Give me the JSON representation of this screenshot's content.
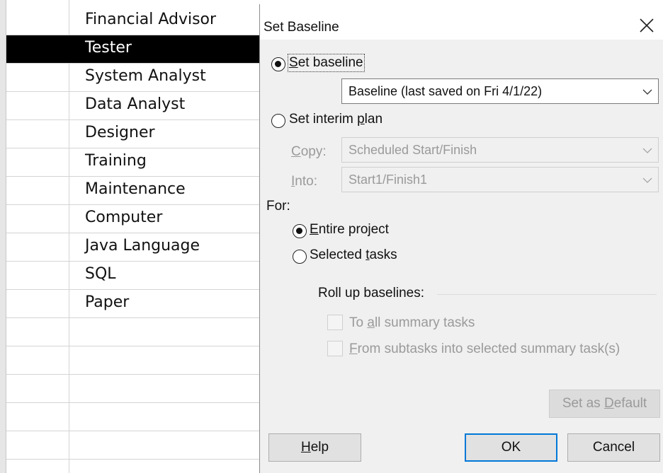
{
  "sheet": {
    "rows": [
      "Financial Advisor",
      "Tester",
      "System Analyst",
      "Data Analyst",
      "Designer",
      "Training",
      "Maintenance",
      "Computer",
      "Java Language",
      "SQL",
      "Paper",
      "",
      "",
      "",
      "",
      "",
      ""
    ],
    "selected_row": "Tester"
  },
  "dialog": {
    "title": "Set Baseline",
    "close_icon": "close-icon",
    "set_baseline": {
      "label_pre": "",
      "label_accel": "S",
      "label_post": "et baseline",
      "checked": true
    },
    "baseline_select": {
      "value": "Baseline (last saved on Fri 4/1/22)"
    },
    "set_interim": {
      "label_pre": "Set interim ",
      "label_accel": "p",
      "label_post": "lan",
      "checked": false
    },
    "copy": {
      "label_accel": "C",
      "label_post": "opy:",
      "value": "Scheduled Start/Finish"
    },
    "into": {
      "label_accel": "I",
      "label_post": "nto:",
      "value": "Start1/Finish1"
    },
    "for_label": "For:",
    "entire_project": {
      "label_accel": "E",
      "label_post": "ntire project",
      "checked": true
    },
    "selected_tasks": {
      "label_pre": "Selected ",
      "label_accel": "t",
      "label_post": "asks",
      "checked": false
    },
    "rollup": {
      "label": "Roll up baselines:",
      "to_all": {
        "label_pre": "To ",
        "label_accel": "a",
        "label_post": "ll summary tasks",
        "checked": false
      },
      "from_sub": {
        "label_accel": "F",
        "label_post": "rom subtasks into selected summary task(s)",
        "checked": false
      }
    },
    "buttons": {
      "set_default": {
        "label_pre": "Set as ",
        "label_accel": "D",
        "label_post": "efault"
      },
      "help": {
        "label_accel": "H",
        "label_post": "elp"
      },
      "ok": "OK",
      "cancel": "Cancel"
    },
    "colors": {
      "accent": "#0078d7",
      "disabled_text": "#9a9a9a",
      "dialog_bg": "#f0f0f0"
    }
  }
}
